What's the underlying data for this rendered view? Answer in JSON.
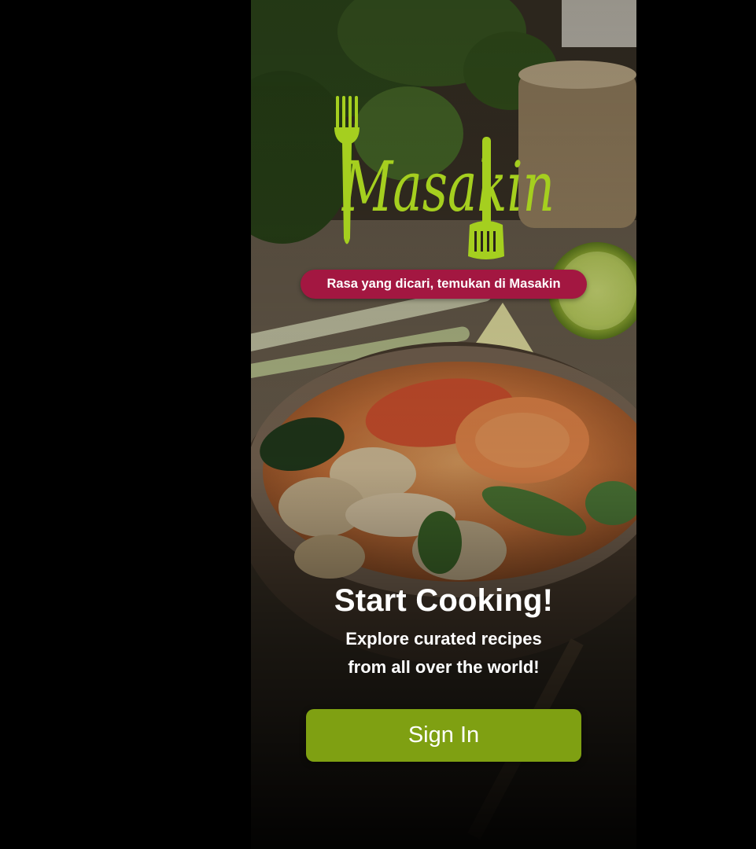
{
  "app": {
    "brand_name": "Masakin",
    "tagline": "Rasa yang dicari, temukan di Masakin",
    "headline": "Start Cooking!",
    "subtitle_line1": "Explore curated recipes",
    "subtitle_line2": "from all over the world!",
    "signin_label": "Sign In"
  },
  "colors": {
    "logo_green": "#a5cf1f",
    "tagline_bg": "#a31741",
    "button_bg": "#7fa012",
    "text": "#ffffff",
    "page_bg": "#000000"
  },
  "icons": {
    "fork": "fork-icon",
    "spatula": "spatula-icon"
  }
}
